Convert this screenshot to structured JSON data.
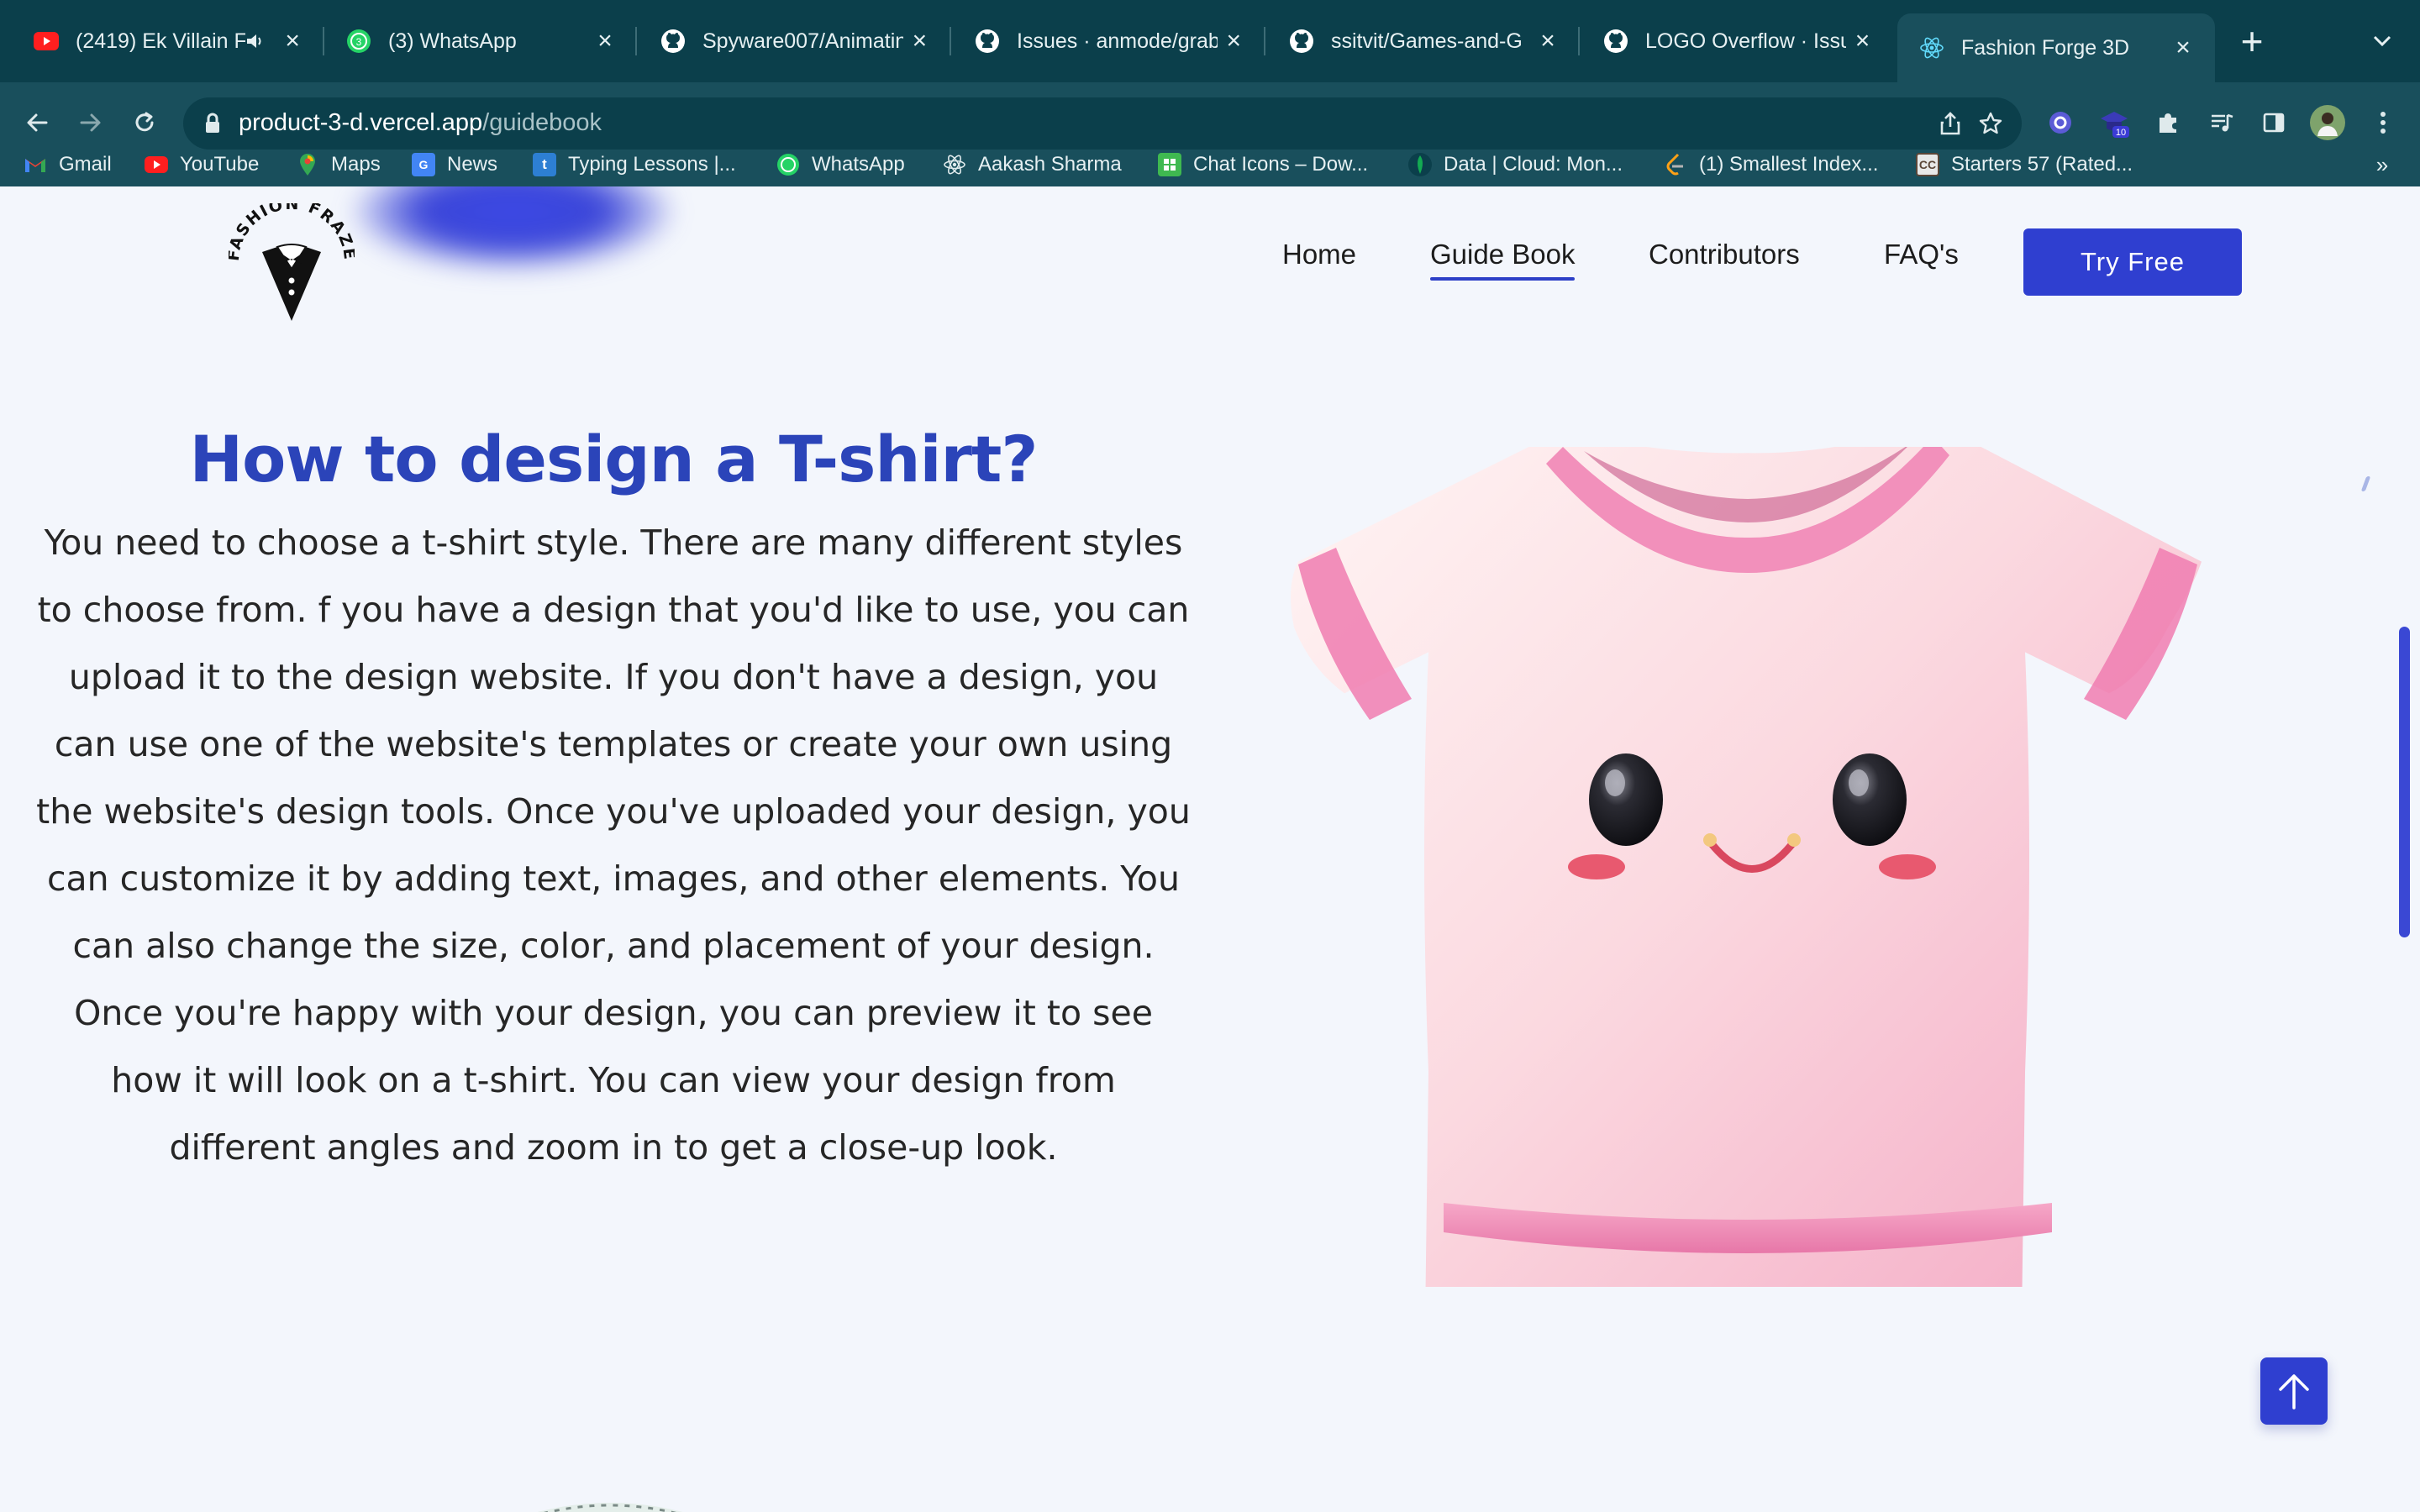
{
  "browser": {
    "tabs": [
      {
        "title": "(2419) Ek Villain F",
        "icon": "youtube-icon",
        "audio": true
      },
      {
        "title": "(3) WhatsApp",
        "icon": "whatsapp-icon",
        "badge": "3"
      },
      {
        "title": "Spyware007/Animatin",
        "icon": "github-icon"
      },
      {
        "title": "Issues · anmode/grab",
        "icon": "github-icon"
      },
      {
        "title": "ssitvit/Games-and-G",
        "icon": "github-icon"
      },
      {
        "title": "LOGO Overflow · Issu",
        "icon": "github-icon"
      },
      {
        "title": "Fashion Forge 3D",
        "icon": "react-icon",
        "active": true
      }
    ],
    "url_host": "product-3-d.vercel.app",
    "url_path": "/guidebook",
    "extension_badge": "10",
    "bookmarks": [
      {
        "label": "Gmail",
        "icon": "gmail-icon"
      },
      {
        "label": "YouTube",
        "icon": "youtube-icon"
      },
      {
        "label": "Maps",
        "icon": "maps-icon"
      },
      {
        "label": "News",
        "icon": "news-icon"
      },
      {
        "label": "Typing Lessons |...",
        "icon": "typing-icon"
      },
      {
        "label": "WhatsApp",
        "icon": "whatsapp-icon"
      },
      {
        "label": "Aakash Sharma",
        "icon": "react-icon"
      },
      {
        "label": "Chat Icons – Dow...",
        "icon": "chat-icons-icon"
      },
      {
        "label": "Data | Cloud: Mon...",
        "icon": "mongodb-icon"
      },
      {
        "label": "(1) Smallest Index...",
        "icon": "leetcode-icon"
      },
      {
        "label": "Starters 57 (Rated...",
        "icon": "codechef-icon"
      }
    ],
    "bookmarks_more": "»"
  },
  "site": {
    "logo_text": "FASHION FRAZE",
    "nav": [
      {
        "label": "Home"
      },
      {
        "label": "Guide Book",
        "active": true
      },
      {
        "label": "Contributors"
      },
      {
        "label": "FAQ's"
      }
    ],
    "cta": "Try Free"
  },
  "guide": {
    "heading": "How to design a T-shirt?",
    "body": "You need to choose a t-shirt style. There are many different styles to choose from. f you have a design that you'd like to use, you can upload it to the design website. If you don't have a design, you can use one of the website's templates or create your own using the website's design tools. Once you've uploaded your design, you can customize it by adding text, images, and other elements. You can also change the size, color, and placement of your design. Once you're happy with your design, you can preview it to see how it will look on a t-shirt. You can view your design from different angles and zoom in to get a close-up look."
  },
  "colors": {
    "chrome_dark": "#0b3f4b",
    "chrome": "#194f5c",
    "accent": "#2f3fd0",
    "heading": "#2b44b9",
    "shirt_pink": "#f2a2c4"
  }
}
